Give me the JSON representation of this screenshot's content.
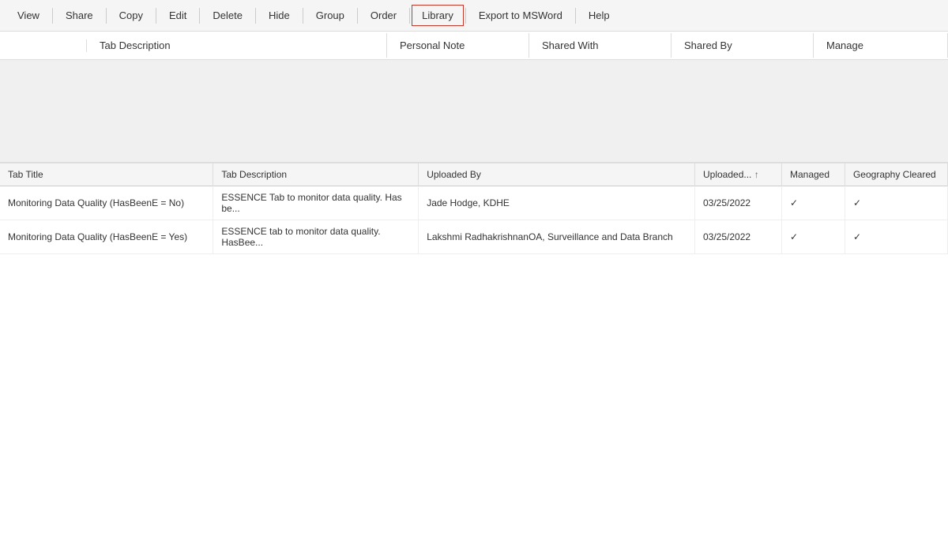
{
  "toolbar": {
    "items": [
      {
        "label": "View",
        "id": "view"
      },
      {
        "label": "Share",
        "id": "share"
      },
      {
        "label": "Copy",
        "id": "copy"
      },
      {
        "label": "Edit",
        "id": "edit"
      },
      {
        "label": "Delete",
        "id": "delete"
      },
      {
        "label": "Hide",
        "id": "hide"
      },
      {
        "label": "Group",
        "id": "group"
      },
      {
        "label": "Order",
        "id": "order"
      },
      {
        "label": "Library",
        "id": "library",
        "active": true
      },
      {
        "label": "Export to MSWord",
        "id": "export"
      },
      {
        "label": "Help",
        "id": "help"
      }
    ]
  },
  "section_headers": {
    "tab_description": "Tab Description",
    "personal_note": "Personal Note",
    "shared_with": "Shared With",
    "shared_by": "Shared By",
    "manage": "Manage"
  },
  "table": {
    "columns": [
      {
        "label": "Tab Title",
        "id": "tab_title"
      },
      {
        "label": "Tab Description",
        "id": "tab_description"
      },
      {
        "label": "Uploaded By",
        "id": "uploaded_by"
      },
      {
        "label": "Uploaded...",
        "id": "uploaded_date",
        "sortable": true,
        "sort_dir": "asc"
      },
      {
        "label": "Managed",
        "id": "managed"
      },
      {
        "label": "Geography Cleared",
        "id": "geography_cleared"
      }
    ],
    "rows": [
      {
        "tab_title": "Monitoring Data Quality (HasBeenE = No)",
        "tab_description": "ESSENCE Tab to monitor data quality. Has be...",
        "uploaded_by": "Jade Hodge, KDHE",
        "uploaded_date": "03/25/2022",
        "managed": "✓",
        "geography_cleared": "✓"
      },
      {
        "tab_title": "Monitoring Data Quality (HasBeenE = Yes)",
        "tab_description": "ESSENCE tab to monitor data quality. HasBee...",
        "uploaded_by": "Lakshmi RadhakrishnanOA, Surveillance and Data Branch",
        "uploaded_date": "03/25/2022",
        "managed": "✓",
        "geography_cleared": "✓"
      }
    ]
  },
  "colors": {
    "active_border": "#c0392b",
    "toolbar_bg": "#f5f5f5",
    "header_bg": "#f5f5f5",
    "gray_area": "#f0f0f0"
  }
}
